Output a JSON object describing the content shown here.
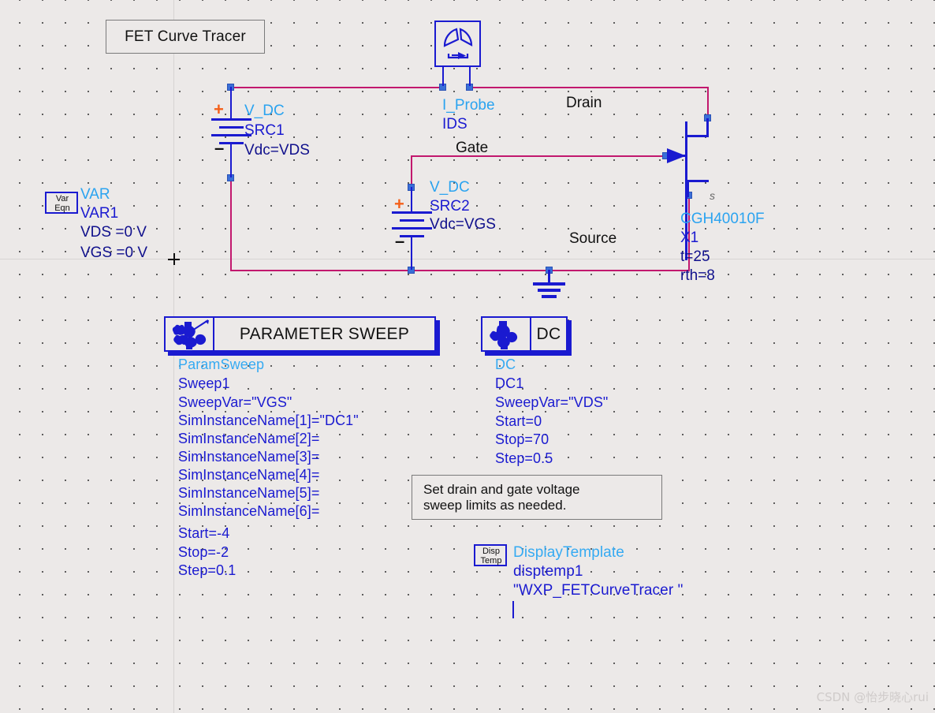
{
  "canvas": {
    "background_color": "#ece9e8",
    "wire_color": "#c2186e",
    "component_color": "#1a1ad0",
    "accent_cyan": "#2aa3f0",
    "plus_color": "#f4601a"
  },
  "title_box": {
    "text": "FET Curve Tracer"
  },
  "var_block": {
    "icon_line1": "Var",
    "icon_line2": "Eqn",
    "type": "VAR",
    "instance": "VAR1",
    "params": [
      "VDS =0 V",
      "VGS =0 V"
    ]
  },
  "src1": {
    "type": "V_DC",
    "instance": "SRC1",
    "param": "Vdc=VDS",
    "plus": "+",
    "minus": "–"
  },
  "src2": {
    "type": "V_DC",
    "instance": "SRC2",
    "param": "Vdc=VGS",
    "plus": "+",
    "minus": "–"
  },
  "iprobe": {
    "type": "I_Probe",
    "instance": "IDS"
  },
  "transistor": {
    "model": "CGH40010F",
    "instance": "X1",
    "param_t": "t=25",
    "param_rth": "rth=8",
    "source_pin_label": "s"
  },
  "net_labels": {
    "drain": "Drain",
    "gate": "Gate",
    "source": "Source"
  },
  "param_sweep": {
    "title": "PARAMETER SWEEP",
    "icon_name": "gears-icon",
    "type": "ParamSweep",
    "instance": "Sweep1",
    "params": [
      "SweepVar=\"VGS\"",
      "SimInstanceName[1]=\"DC1\"",
      "SimInstanceName[2]=",
      "SimInstanceName[3]=",
      "SimInstanceName[4]=",
      "SimInstanceName[5]=",
      "SimInstanceName[6]=",
      "Start=-4",
      "Stop=-2",
      "Step=0.1"
    ]
  },
  "dc_block": {
    "title": "DC",
    "icon_name": "gears-icon",
    "type": "DC",
    "instance": "DC1",
    "params": [
      "SweepVar=\"VDS\"",
      "Start=0",
      "Stop=70",
      "Step=0.5"
    ]
  },
  "note": {
    "line1": "Set drain and gate voltage",
    "line2": "sweep limits as needed."
  },
  "display_template": {
    "icon_line1": "Disp",
    "icon_line2": "Temp",
    "type": "DisplayTemplate",
    "instance": "disptemp1",
    "value": "\"WXP_FETCurveTracer \""
  },
  "watermark": {
    "text": "CSDN @怡步晓心rui"
  }
}
